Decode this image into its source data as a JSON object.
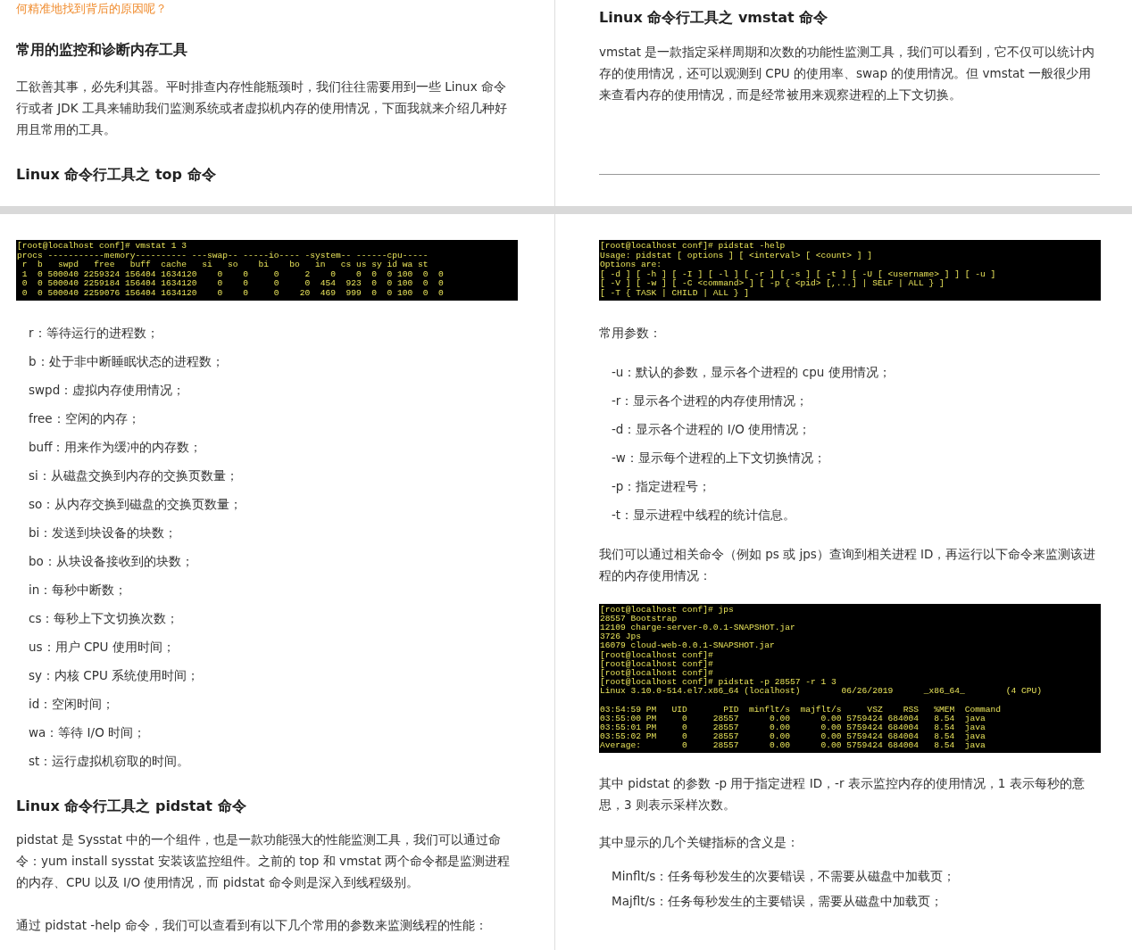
{
  "top_left": {
    "lead_in": "何精准地找到背后的原因呢？",
    "heading": "常用的监控和诊断内存工具",
    "paragraph": "工欲善其事，必先利其器。平时排查内存性能瓶颈时，我们往往需要用到一些 Linux 命令行或者 JDK 工具来辅助我们监测系统或者虚拟机内存的使用情况，下面我就来介绍几种好用且常用的工具。",
    "subheading": "Linux 命令行工具之 top 命令"
  },
  "top_right": {
    "heading": "Linux 命令行工具之 vmstat 命令",
    "paragraph": "vmstat 是一款指定采样周期和次数的功能性监测工具，我们可以看到，它不仅可以统计内存的使用情况，还可以观测到 CPU 的使用率、swap 的使用情况。但 vmstat 一般很少用来查看内存的使用情况，而是经常被用来观察进程的上下文切换。"
  },
  "bottom_left": {
    "terminal": [
      "[root@localhost conf]# vmstat 1 3",
      "procs -----------memory---------- ---swap-- -----io---- -system-- ------cpu-----",
      " r  b   swpd   free   buff  cache   si   so    bi    bo   in   cs us sy id wa st",
      " 1  0 500040 2259324 156404 1634120    0    0     0     2    0    0  0  0 100  0  0",
      " 0  0 500040 2259184 156404 1634120    0    0     0     0  454  923  0  0 100  0  0",
      " 0  0 500040 2259076 156404 1634120    0    0     0    20  469  999  0  0 100  0  0"
    ],
    "fields": [
      "r：等待运行的进程数；",
      "b：处于非中断睡眠状态的进程数；",
      "swpd：虚拟内存使用情况；",
      "free：空闲的内存；",
      "buff：用来作为缓冲的内存数；",
      "si：从磁盘交换到内存的交换页数量；",
      "so：从内存交换到磁盘的交换页数量；",
      "bi：发送到块设备的块数；",
      "bo：从块设备接收到的块数；",
      "in：每秒中断数；",
      "cs：每秒上下文切换次数；",
      "us：用户 CPU 使用时间；",
      "sy：内核 CPU 系统使用时间；",
      "id：空闲时间；",
      "wa：等待 I/O 时间；",
      "st：运行虚拟机窃取的时间。"
    ],
    "heading": "Linux 命令行工具之 pidstat 命令",
    "paragraphs": [
      "pidstat 是 Sysstat 中的一个组件，也是一款功能强大的性能监测工具，我们可以通过命令：yum install sysstat 安装该监控组件。之前的 top 和 vmstat 两个命令都是监测进程的内存、CPU 以及 I/O 使用情况，而 pidstat 命令则是深入到线程级别。",
      "通过 pidstat -help 命令，我们可以查看到有以下几个常用的参数来监测线程的性能："
    ]
  },
  "bottom_right": {
    "terminal": [
      "[root@localhost conf]# pidstat -help",
      "Usage: pidstat [ options ] [ <interval> [ <count> ] ]",
      "Options are:",
      "[ -d ] [ -h ] [ -I ] [ -l ] [ -r ] [ -s ] [ -t ] [ -U [ <username> ] ] [ -u ]",
      "[ -V ] [ -w ] [ -C <command> ] [ -p { <pid> [,...] | SELF | ALL } ]",
      "[ -T { TASK | CHILD | ALL } ]"
    ],
    "params_label": "常用参数：",
    "options": [
      "-u：默认的参数，显示各个进程的 cpu 使用情况；",
      "-r：显示各个进程的内存使用情况；",
      "-d：显示各个进程的 I/O 使用情况；",
      "-w：显示每个进程的上下文切换情况；",
      "-p：指定进程号；",
      "-t：显示进程中线程的统计信息。"
    ],
    "paragraph": "我们可以通过相关命令（例如 ps 或 jps）查询到相关进程 ID，再运行以下命令来监测该进程的内存使用情况：",
    "terminal_2_line_groups": [
      [
        "[root@localhost conf]# jps",
        "28557 Bootstrap",
        "12109 charge-server-0.0.1-SNAPSHOT.jar",
        "3726 Jps",
        "16079 cloud-web-0.0.1-SNAPSHOT.jar",
        "[root@localhost conf]#",
        "[root@localhost conf]#",
        "[root@localhost conf]#",
        "[root@localhost conf]# pidstat -p 28557 -r 1 3",
        "Linux 3.10.0-514.el7.x86_64 (localhost)        06/26/2019      _x86_64_        (4 CPU)"
      ],
      [
        "03:54:59 PM   UID       PID  minflt/s  majflt/s     VSZ    RSS   %MEM  Command",
        "03:55:00 PM     0     28557      0.00      0.00 5759424 684004   8.54  java",
        "03:55:01 PM     0     28557      0.00      0.00 5759424 684004   8.54  java",
        "03:55:02 PM     0     28557      0.00      0.00 5759424 684004   8.54  java",
        "Average:        0     28557      0.00      0.00 5759424 684004   8.54  java"
      ]
    ],
    "paragraph_2": "其中 pidstat 的参数 -p 用于指定进程 ID，-r 表示监控内存的使用情况，1 表示每秒的意思，3 则表示采样次数。",
    "metrics_label": "其中显示的几个关键指标的含义是：",
    "metrics": [
      "Minflt/s：任务每秒发生的次要错误，不需要从磁盘中加载页；",
      "Majflt/s：任务每秒发生的主要错误，需要从磁盘中加载页；"
    ]
  }
}
